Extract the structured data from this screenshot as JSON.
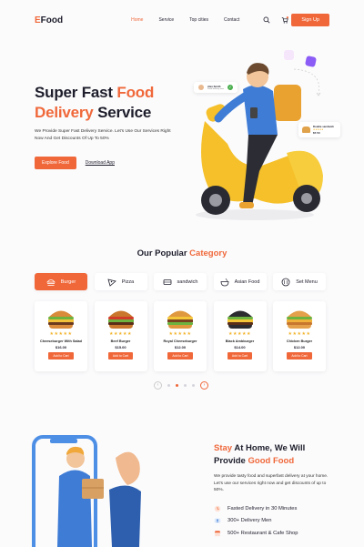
{
  "brand": {
    "logo_first": "E",
    "logo_rest": "Food"
  },
  "nav": {
    "links": [
      "Home",
      "Service",
      "Top cities",
      "Contact"
    ],
    "signup": "Sign Up"
  },
  "hero": {
    "title_line1_a": "Super Fast ",
    "title_line1_b": "Food",
    "title_line2_a": "Delivery",
    "title_line2_b": " Service",
    "description": "We Provide Super Fast Delivery Service. Let's Use Our Services Right Now And Get Discounts Of Up To 50%",
    "explore": "Explore Food",
    "download": "Download App",
    "review_name": "Alex Smith",
    "review_sub": "Food delivery man",
    "food_card_name": "Double sandwich",
    "food_card_stars": "★★★★★",
    "food_card_price": "$7.50"
  },
  "category": {
    "title_a": "Our Popular ",
    "title_b": "Category",
    "tabs": [
      "Burger",
      "Pizza",
      "sandwich",
      "Asian Food",
      "Set Menu"
    ],
    "cards": [
      {
        "name": "Cheeseburger With Salad",
        "price": "$16.00",
        "button": "Add to Cart",
        "stars": "★★★★★"
      },
      {
        "name": "Beef Burger",
        "price": "$15.00",
        "button": "Add to Cart",
        "stars": "★★★★★"
      },
      {
        "name": "Royal Cheeseburger",
        "price": "$12.00",
        "button": "Add to Cart",
        "stars": "★★★★★"
      },
      {
        "name": "Black Ambburger",
        "price": "$14.00",
        "button": "Add to Cart",
        "stars": "★★★★★"
      },
      {
        "name": "Chicken Burger",
        "price": "$12.00",
        "button": "Add to Cart",
        "stars": "★★★★★"
      }
    ],
    "pager_prev": "‹",
    "pager_next": "›",
    "pager_pages": 4,
    "pager_active_page": 1
  },
  "stay": {
    "title_a": "Stay",
    "title_b": " At Home, We Will",
    "title_c": "Provide ",
    "title_d": "Good Food",
    "description": "We provide tasty food and superfast delivery at your home. Let's use our services right now and get discounts of up to 50%.",
    "features": [
      "Fasted Delivery in 30 Minutes",
      "300+ Delivery Men",
      "500+ Restaurant & Cafe Shop"
    ]
  },
  "colors": {
    "accent": "#f0683a",
    "star": "#f3b32a",
    "scooter": "#f5c02a"
  },
  "icons": [
    "search-icon",
    "cart-icon",
    "burger-icon",
    "pizza-icon",
    "sandwich-icon",
    "bowl-icon",
    "menu-icon",
    "clock-icon",
    "delivery-man-icon",
    "store-icon"
  ]
}
